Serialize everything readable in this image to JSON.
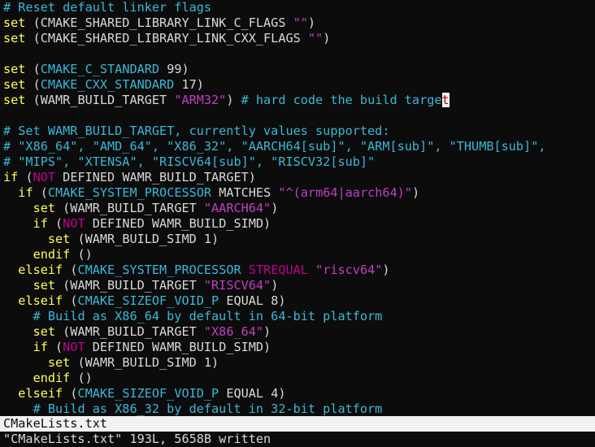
{
  "editor": {
    "lines": [
      [
        {
          "t": "# Reset default linker flags",
          "c": "comment"
        }
      ],
      [
        {
          "t": "set",
          "c": "keyword"
        },
        {
          "t": " (CMAKE_SHARED_LIBRARY_LINK_C_FLAGS ",
          "c": "plain"
        },
        {
          "t": "\"\"",
          "c": "string"
        },
        {
          "t": ")",
          "c": "plain"
        }
      ],
      [
        {
          "t": "set",
          "c": "keyword"
        },
        {
          "t": " (CMAKE_SHARED_LIBRARY_LINK_CXX_FLAGS ",
          "c": "plain"
        },
        {
          "t": "\"\"",
          "c": "string"
        },
        {
          "t": ")",
          "c": "plain"
        }
      ],
      [],
      [
        {
          "t": "set",
          "c": "keyword"
        },
        {
          "t": " (",
          "c": "plain"
        },
        {
          "t": "CMAKE_C_STANDARD",
          "c": "var"
        },
        {
          "t": " 99)",
          "c": "plain"
        }
      ],
      [
        {
          "t": "set",
          "c": "keyword"
        },
        {
          "t": " (",
          "c": "plain"
        },
        {
          "t": "CMAKE_CXX_STANDARD",
          "c": "var"
        },
        {
          "t": " 17)",
          "c": "plain"
        }
      ],
      [
        {
          "t": "set",
          "c": "keyword"
        },
        {
          "t": " (WAMR_BUILD_TARGET ",
          "c": "plain"
        },
        {
          "t": "\"ARM32\"",
          "c": "string"
        },
        {
          "t": ") ",
          "c": "plain"
        },
        {
          "t": "# hard code the build targe",
          "c": "comment"
        },
        {
          "t": "t",
          "c": "cursor"
        }
      ],
      [],
      [
        {
          "t": "# Set WAMR_BUILD_TARGET, currently values supported:",
          "c": "comment"
        }
      ],
      [
        {
          "t": "# \"X86_64\", \"AMD_64\", \"X86_32\", \"AARCH64[sub]\", \"ARM[sub]\", \"THUMB[sub]\",",
          "c": "comment"
        }
      ],
      [
        {
          "t": "# \"MIPS\", \"XTENSA\", \"RISCV64[sub]\", \"RISCV32[sub]\"",
          "c": "comment"
        }
      ],
      [
        {
          "t": "if",
          "c": "keyword"
        },
        {
          "t": " (",
          "c": "plain"
        },
        {
          "t": "NOT",
          "c": "const"
        },
        {
          "t": " DEFINED WAMR_BUILD_TARGET)",
          "c": "plain"
        }
      ],
      [
        {
          "t": "  ",
          "c": "plain"
        },
        {
          "t": "if",
          "c": "keyword"
        },
        {
          "t": " (",
          "c": "plain"
        },
        {
          "t": "CMAKE_SYSTEM_PROCESSOR",
          "c": "var"
        },
        {
          "t": " MATCHES ",
          "c": "plain"
        },
        {
          "t": "\"^(arm64|aarch64)\"",
          "c": "string"
        },
        {
          "t": ")",
          "c": "plain"
        }
      ],
      [
        {
          "t": "    ",
          "c": "plain"
        },
        {
          "t": "set",
          "c": "keyword"
        },
        {
          "t": " (WAMR_BUILD_TARGET ",
          "c": "plain"
        },
        {
          "t": "\"AARCH64\"",
          "c": "string"
        },
        {
          "t": ")",
          "c": "plain"
        }
      ],
      [
        {
          "t": "    ",
          "c": "plain"
        },
        {
          "t": "if",
          "c": "keyword"
        },
        {
          "t": " (",
          "c": "plain"
        },
        {
          "t": "NOT",
          "c": "const"
        },
        {
          "t": " DEFINED WAMR_BUILD_SIMD)",
          "c": "plain"
        }
      ],
      [
        {
          "t": "      ",
          "c": "plain"
        },
        {
          "t": "set",
          "c": "keyword"
        },
        {
          "t": " (WAMR_BUILD_SIMD 1)",
          "c": "plain"
        }
      ],
      [
        {
          "t": "    ",
          "c": "plain"
        },
        {
          "t": "endif",
          "c": "keyword"
        },
        {
          "t": " ()",
          "c": "plain"
        }
      ],
      [
        {
          "t": "  ",
          "c": "plain"
        },
        {
          "t": "elseif",
          "c": "keyword"
        },
        {
          "t": " (",
          "c": "plain"
        },
        {
          "t": "CMAKE_SYSTEM_PROCESSOR",
          "c": "var"
        },
        {
          "t": " ",
          "c": "plain"
        },
        {
          "t": "STREQUAL",
          "c": "const"
        },
        {
          "t": " ",
          "c": "plain"
        },
        {
          "t": "\"riscv64\"",
          "c": "string"
        },
        {
          "t": ")",
          "c": "plain"
        }
      ],
      [
        {
          "t": "    ",
          "c": "plain"
        },
        {
          "t": "set",
          "c": "keyword"
        },
        {
          "t": " (WAMR_BUILD_TARGET ",
          "c": "plain"
        },
        {
          "t": "\"RISCV64\"",
          "c": "string"
        },
        {
          "t": ")",
          "c": "plain"
        }
      ],
      [
        {
          "t": "  ",
          "c": "plain"
        },
        {
          "t": "elseif",
          "c": "keyword"
        },
        {
          "t": " (",
          "c": "plain"
        },
        {
          "t": "CMAKE_SIZEOF_VOID_P",
          "c": "var"
        },
        {
          "t": " EQUAL 8)",
          "c": "plain"
        }
      ],
      [
        {
          "t": "    ",
          "c": "plain"
        },
        {
          "t": "# Build as X86_64 by default in 64-bit platform",
          "c": "comment"
        }
      ],
      [
        {
          "t": "    ",
          "c": "plain"
        },
        {
          "t": "set",
          "c": "keyword"
        },
        {
          "t": " (WAMR_BUILD_TARGET ",
          "c": "plain"
        },
        {
          "t": "\"X86_64\"",
          "c": "string"
        },
        {
          "t": ")",
          "c": "plain"
        }
      ],
      [
        {
          "t": "    ",
          "c": "plain"
        },
        {
          "t": "if",
          "c": "keyword"
        },
        {
          "t": " (",
          "c": "plain"
        },
        {
          "t": "NOT",
          "c": "const"
        },
        {
          "t": " DEFINED WAMR_BUILD_SIMD)",
          "c": "plain"
        }
      ],
      [
        {
          "t": "      ",
          "c": "plain"
        },
        {
          "t": "set",
          "c": "keyword"
        },
        {
          "t": " (WAMR_BUILD_SIMD 1)",
          "c": "plain"
        }
      ],
      [
        {
          "t": "    ",
          "c": "plain"
        },
        {
          "t": "endif",
          "c": "keyword"
        },
        {
          "t": " ()",
          "c": "plain"
        }
      ],
      [
        {
          "t": "  ",
          "c": "plain"
        },
        {
          "t": "elseif",
          "c": "keyword"
        },
        {
          "t": " (",
          "c": "plain"
        },
        {
          "t": "CMAKE_SIZEOF_VOID_P",
          "c": "var"
        },
        {
          "t": " EQUAL 4)",
          "c": "plain"
        }
      ],
      [
        {
          "t": "    ",
          "c": "plain"
        },
        {
          "t": "# Build as X86_32 by default in 32-bit platform",
          "c": "comment"
        }
      ]
    ]
  },
  "statusbar": {
    "filename": "CMakeLists.txt"
  },
  "message": {
    "text": "\"CMakeLists.txt\" 193L, 5658B written"
  },
  "colors": {
    "background": "#0c0c0c",
    "comment": "#3ab8d8",
    "keyword": "#ffff55",
    "string": "#c040c0",
    "constant": "#c00090",
    "plain": "#d9d9d9",
    "statusbar_bg": "#f2f2f2"
  }
}
